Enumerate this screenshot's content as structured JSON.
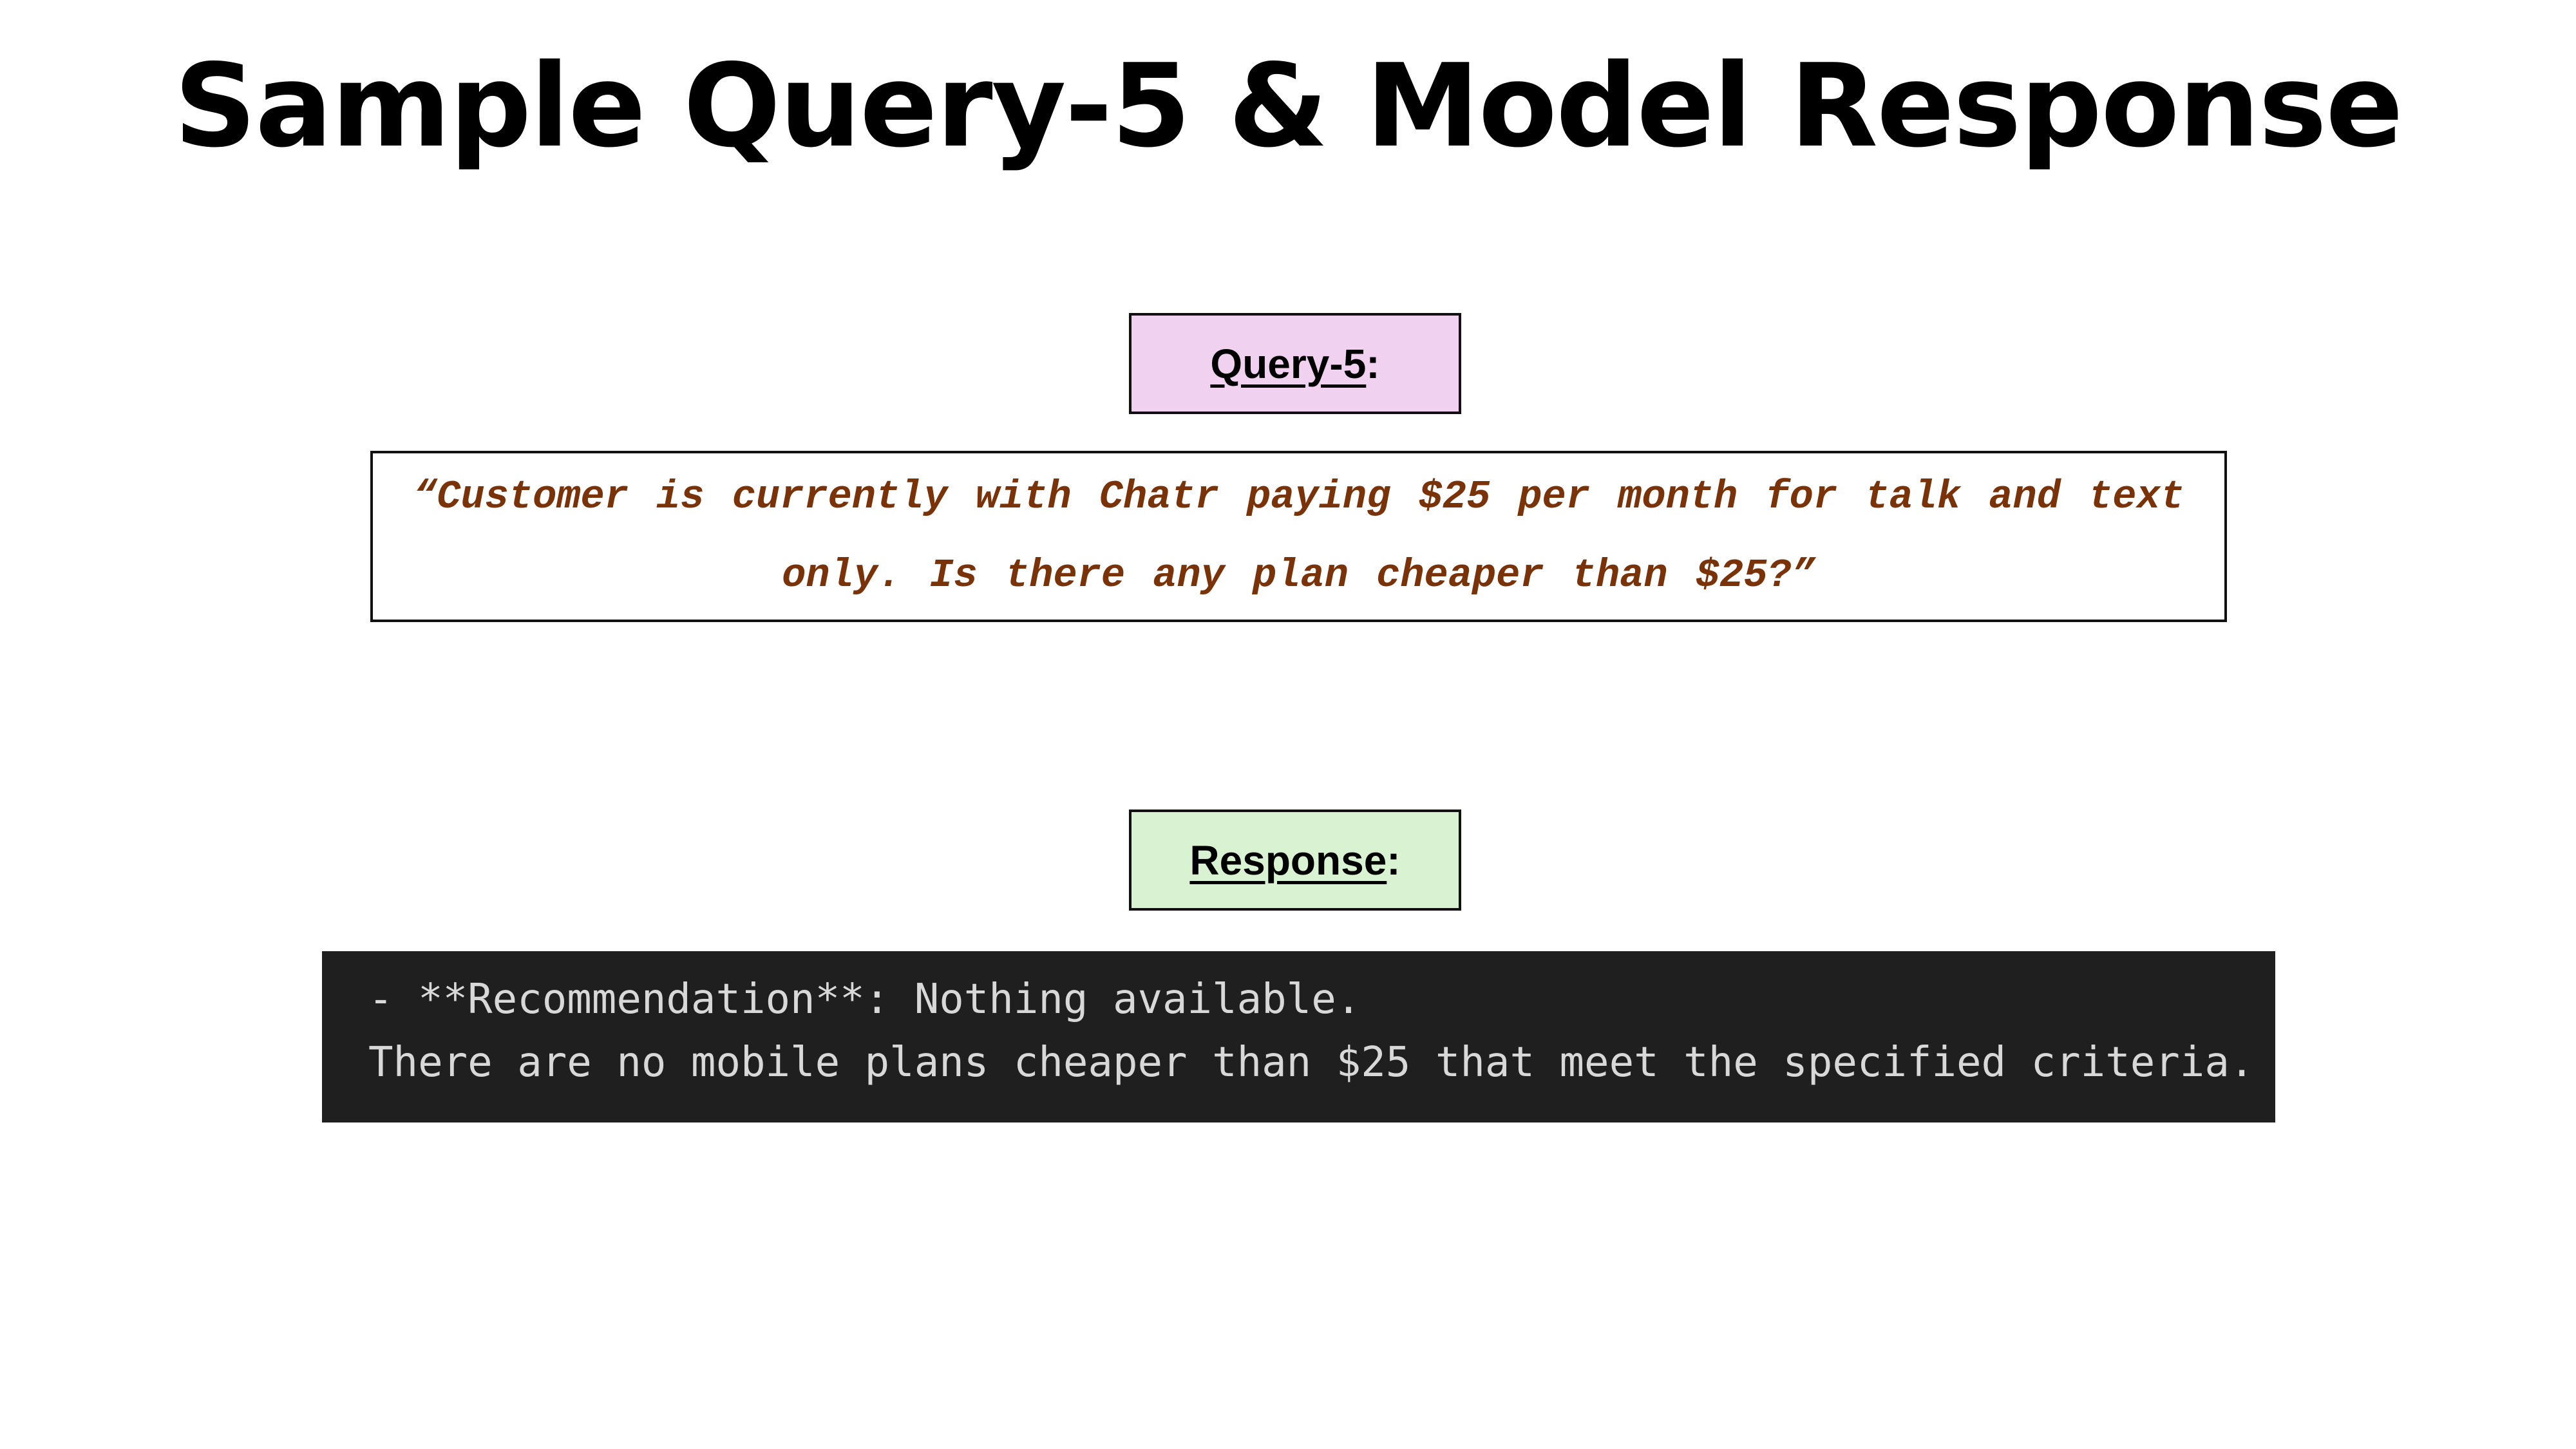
{
  "slide": {
    "title": "Sample Query-5 & Model Response"
  },
  "query": {
    "label": "Query-5",
    "label_suffix": ":",
    "text": "“Customer is currently with Chatr paying $25 per month for talk and text only. Is there any plan cheaper than $25?”",
    "label_bg": "#f1d1f0",
    "text_color": "#7a3208"
  },
  "response": {
    "label": "Response",
    "label_suffix": ":",
    "label_bg": "#d9f3d2",
    "lines": [
      "- **Recommendation**: Nothing available.",
      "There are no mobile plans cheaper than $25 that meet the specified criteria."
    ],
    "box_bg": "#1f1f1f",
    "text_color": "#d8d8d8"
  }
}
